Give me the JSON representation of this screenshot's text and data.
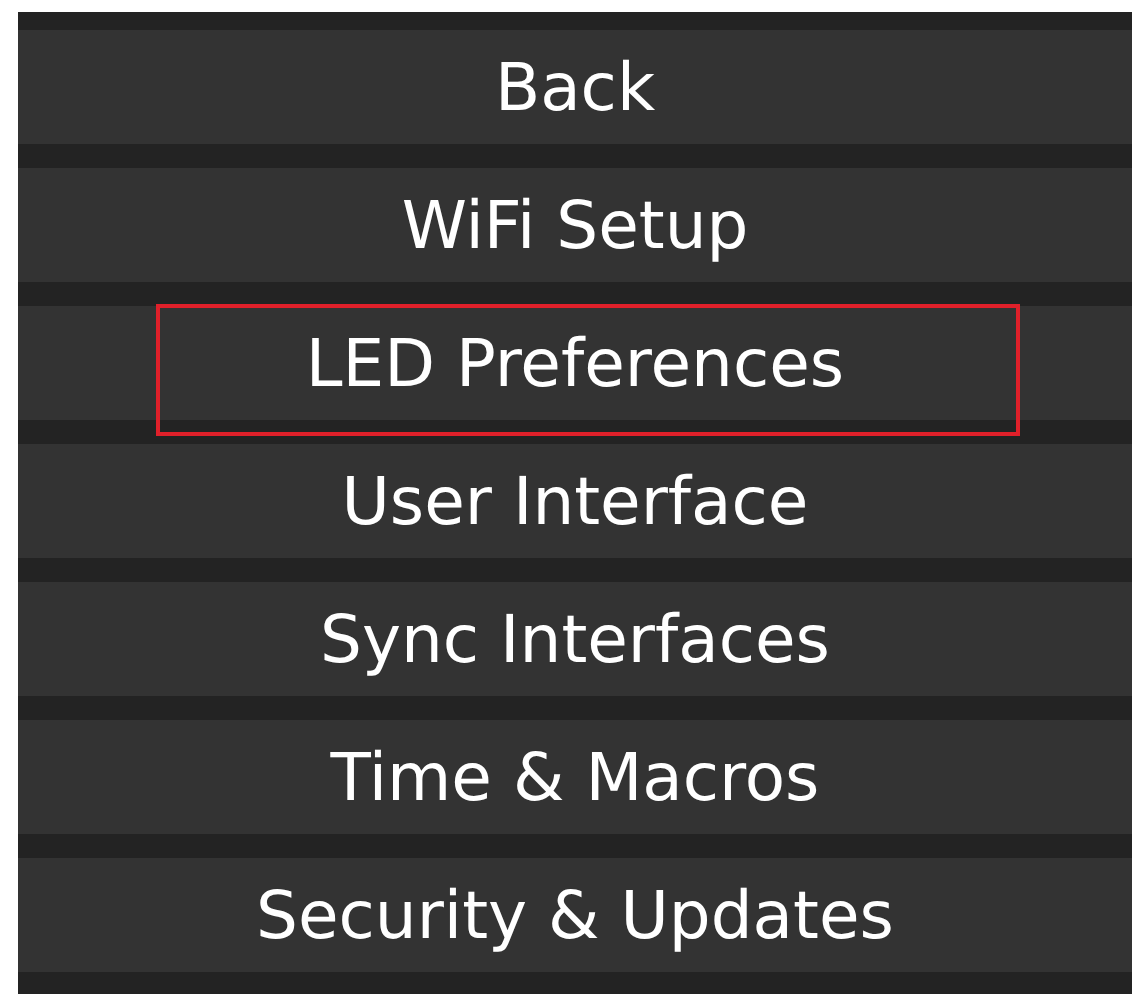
{
  "menu": {
    "items": [
      {
        "label": "Back",
        "selected": false
      },
      {
        "label": "WiFi Setup",
        "selected": false
      },
      {
        "label": "LED Preferences",
        "selected": true
      },
      {
        "label": "User Interface",
        "selected": false
      },
      {
        "label": "Sync Interfaces",
        "selected": false
      },
      {
        "label": "Time & Macros",
        "selected": false
      },
      {
        "label": "Security & Updates",
        "selected": false
      }
    ]
  }
}
